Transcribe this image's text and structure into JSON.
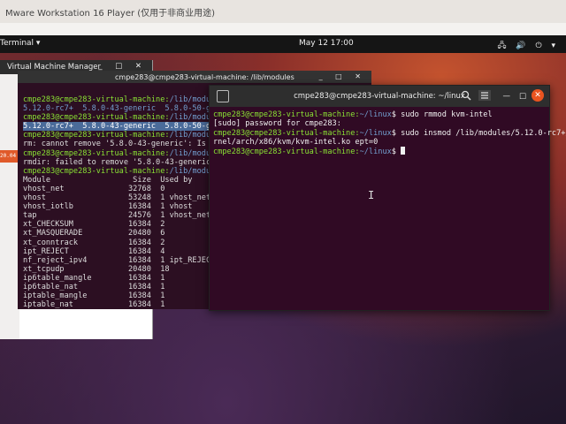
{
  "window": {
    "ws_title": "Mware Workstation 16 Player (仅用于非商业用途)",
    "activities": "Terminal ▾",
    "clock": "May 12  17:00",
    "tray": "🖧 🔊 ⏻ ▾"
  },
  "vmm": {
    "title": "Virtual Machine Manager",
    "badge": "20.04",
    "controls": "_ □ ✕"
  },
  "back_terminal": {
    "title": "cmpe283@cmpe283-virtual-machine: /lib/modules",
    "controls": "_ □ ✕",
    "prompt": "cmpe283@cmpe283-virtual-machine:",
    "path": "/lib/modules",
    "lines": [
      "5.12.0-rc7+  5.8.0-43-generic  5.8.0-50-generic",
      "5.12.0-rc7+  5.8.0-43-generic  5.8.0-50-generic",
      "rm: cannot remove '5.8.0-43-generic': Is a directory",
      "rmdir: failed to remove '5.8.0-43-generic': Directory not empty"
    ],
    "table_header": "Module                  Size  Used by",
    "modules": [
      "vhost_net              32768  0",
      "vhost                  53248  1 vhost_net",
      "vhost_iotlb            16384  1 vhost",
      "tap                    24576  1 vhost_net",
      "xt_CHECKSUM            16384  2",
      "xt_MASQUERADE          20480  6",
      "xt_conntrack           16384  2",
      "ipt_REJECT             16384  4",
      "nf_reject_ipv4         16384  1 ipt_REJECT",
      "xt_tcpudp              20480  18",
      "ip6table_mangle        16384  1",
      "ip6table_nat           16384  1",
      "iptable_mangle         16384  1",
      "iptable_nat            16384  1"
    ]
  },
  "front_terminal": {
    "title": "cmpe283@cmpe283-virtual-machine: ~/linux",
    "prompt": "cmpe283@cmpe283-virtual-machine:",
    "path": "~/linux",
    "cmd1": "sudo rmmod kvm-intel",
    "sudo_line": "[sudo] password for cmpe283:",
    "cmd2": "sudo insmod /lib/modules/5.12.0-rc7+/ke",
    "cmd2_wrap": "rnel/arch/x86/kvm/kvm-intel.ko ept=0"
  },
  "colors": {
    "prompt_green": "#8ae234",
    "path_blue": "#729fcf",
    "terminal_bg": "#300a24",
    "ubuntu_orange": "#e95420"
  }
}
